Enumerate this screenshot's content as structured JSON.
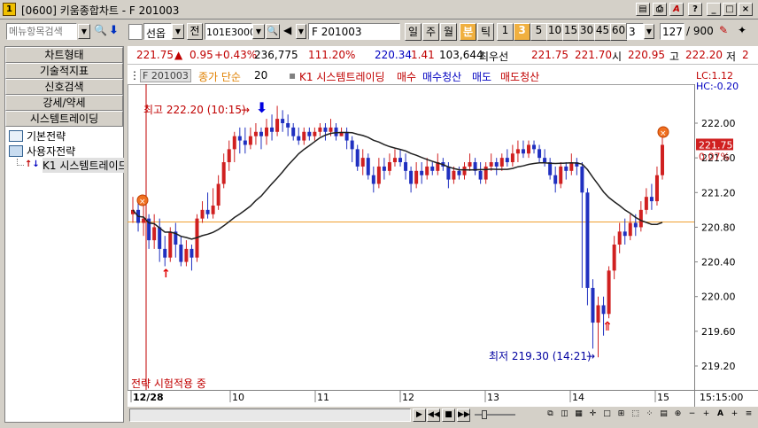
{
  "window": {
    "app_icon": "1",
    "title": "[0600] 키움종합차트 - F 201003",
    "title_buttons": [
      "chart-icon",
      "print-icon",
      "A",
      "?",
      "_",
      "□",
      "×"
    ]
  },
  "toolbar": {
    "menu_search_placeholder": "메뉴항목검색",
    "market": "선옵",
    "jeon": "전",
    "code": "101E3000",
    "name": "F 201003",
    "periods": [
      "일",
      "주",
      "월",
      "분",
      "틱",
      "1",
      "3",
      "5",
      "10",
      "15",
      "30",
      "45",
      "60"
    ],
    "selected_period": "분",
    "selected_value": "3",
    "interval_input": "3",
    "count_input": "127",
    "count_total": "/ 900"
  },
  "sidebar": {
    "buttons": [
      "차트형태",
      "기술적지표",
      "신호검색",
      "강세/약세",
      "시스템트레이딩"
    ],
    "tree": [
      {
        "label": "기본전략",
        "icon": "folder-icon"
      },
      {
        "label": "사용자전략",
        "icon": "folder-open-icon"
      },
      {
        "label": "K1 시스템트레이드",
        "icon": "strategy-icon"
      }
    ]
  },
  "quote": {
    "price": "221.75",
    "change_arrow": "▲",
    "change": "0.95",
    "change_pct": "+0.43%",
    "volume": "236,775",
    "volume_pct": "111.20%",
    "value1": "220.34",
    "value2": "1.41",
    "value3": "103,644",
    "best_label": "최우선",
    "best_bid": "221.75",
    "best_ask": "221.70",
    "open_label": "시",
    "open": "220.95",
    "high_label": "고",
    "high": "222.20",
    "low_label": "저",
    "low": "2"
  },
  "legend": {
    "symbol": "F 201003",
    "ma_label": "종가 단순",
    "ma_period": "20",
    "strategy": "K1 시스템트레이딩",
    "buy": "매수",
    "buy_exit": "매수청산",
    "sell": "매도",
    "sell_exit": "매도청산",
    "lc": "LC:1.12",
    "hc": "HC:-0.20"
  },
  "annotations": {
    "high_text": "최고 222.20 (10:15)",
    "low_text": "최저 219.30 (14:21)",
    "status_text": "전략 시험적용 중",
    "price_tag": "221.75",
    "pct_tag": "0.07%"
  },
  "chart_data": {
    "type": "candlestick",
    "y_ticks": [
      "222.00",
      "221.60",
      "221.20",
      "220.80",
      "220.40",
      "220.00",
      "219.60",
      "219.20"
    ],
    "ylim": [
      219.0,
      222.5
    ],
    "x_ticks": [
      "12/28",
      "10",
      "11",
      "12",
      "13",
      "14",
      "15"
    ],
    "time_label": "15:15:00",
    "reference_line": 220.86,
    "last_price": 221.75,
    "high": 222.2,
    "high_time": "10:15",
    "low": 219.3,
    "low_time": "14:21",
    "candles": [
      [
        220.95,
        221.0,
        221.15,
        220.85
      ],
      [
        221.0,
        220.85,
        221.1,
        220.75
      ],
      [
        220.85,
        220.9,
        221.05,
        220.7
      ],
      [
        220.9,
        220.65,
        220.95,
        220.55
      ],
      [
        220.65,
        220.8,
        220.95,
        220.55
      ],
      [
        220.8,
        220.55,
        220.9,
        220.4
      ],
      [
        220.55,
        220.45,
        220.7,
        220.35
      ],
      [
        220.45,
        220.75,
        220.8,
        220.4
      ],
      [
        220.75,
        220.6,
        220.85,
        220.45
      ],
      [
        220.6,
        220.4,
        220.7,
        220.35
      ],
      [
        220.4,
        220.55,
        220.65,
        220.35
      ],
      [
        220.55,
        220.45,
        220.6,
        220.3
      ],
      [
        220.45,
        220.9,
        220.95,
        220.4
      ],
      [
        220.9,
        221.0,
        221.1,
        220.85
      ],
      [
        221.0,
        220.95,
        221.2,
        220.9
      ],
      [
        220.95,
        221.05,
        221.25,
        220.9
      ],
      [
        221.05,
        221.3,
        221.4,
        221.0
      ],
      [
        221.3,
        221.55,
        221.65,
        221.25
      ],
      [
        221.55,
        221.7,
        221.8,
        221.45
      ],
      [
        221.7,
        221.85,
        221.9,
        221.55
      ],
      [
        221.85,
        221.8,
        221.95,
        221.65
      ],
      [
        221.8,
        221.75,
        221.95,
        221.65
      ],
      [
        221.75,
        221.85,
        221.95,
        221.7
      ],
      [
        221.85,
        221.9,
        222.0,
        221.75
      ],
      [
        221.9,
        221.85,
        221.95,
        221.7
      ],
      [
        221.85,
        221.95,
        222.05,
        221.75
      ],
      [
        221.95,
        221.9,
        222.1,
        221.8
      ],
      [
        221.9,
        222.05,
        222.2,
        221.85
      ],
      [
        222.05,
        222.0,
        222.15,
        221.9
      ],
      [
        222.0,
        221.95,
        222.1,
        221.85
      ],
      [
        221.95,
        221.85,
        222.0,
        221.8
      ],
      [
        221.85,
        221.8,
        221.95,
        221.75
      ],
      [
        221.8,
        221.9,
        221.95,
        221.75
      ],
      [
        221.9,
        221.85,
        221.95,
        221.8
      ],
      [
        221.85,
        221.9,
        221.95,
        221.8
      ],
      [
        221.9,
        221.95,
        222.0,
        221.85
      ],
      [
        221.95,
        221.9,
        222.0,
        221.8
      ],
      [
        221.9,
        221.95,
        222.05,
        221.85
      ],
      [
        221.95,
        221.85,
        222.0,
        221.8
      ],
      [
        221.85,
        221.9,
        221.95,
        221.85
      ],
      [
        221.9,
        221.8,
        221.95,
        221.7
      ],
      [
        221.8,
        221.7,
        221.85,
        221.55
      ],
      [
        221.7,
        221.5,
        221.75,
        221.45
      ],
      [
        221.5,
        221.6,
        221.7,
        221.4
      ],
      [
        221.6,
        221.4,
        221.65,
        221.35
      ],
      [
        221.4,
        221.3,
        221.5,
        221.2
      ],
      [
        221.3,
        221.5,
        221.6,
        221.25
      ],
      [
        221.5,
        221.45,
        221.6,
        221.35
      ],
      [
        221.45,
        221.55,
        221.65,
        221.4
      ],
      [
        221.55,
        221.6,
        221.7,
        221.5
      ],
      [
        221.6,
        221.55,
        221.7,
        221.5
      ],
      [
        221.55,
        221.45,
        221.65,
        221.35
      ],
      [
        221.45,
        221.3,
        221.5,
        221.2
      ],
      [
        221.3,
        221.45,
        221.55,
        221.25
      ],
      [
        221.45,
        221.4,
        221.55,
        221.3
      ],
      [
        221.4,
        221.5,
        221.6,
        221.35
      ],
      [
        221.5,
        221.45,
        221.55,
        221.4
      ],
      [
        221.45,
        221.55,
        221.65,
        221.4
      ],
      [
        221.55,
        221.5,
        221.6,
        221.45
      ],
      [
        221.5,
        221.35,
        221.55,
        221.25
      ],
      [
        221.35,
        221.45,
        221.5,
        221.3
      ],
      [
        221.45,
        221.4,
        221.5,
        221.35
      ],
      [
        221.4,
        221.5,
        221.55,
        221.35
      ],
      [
        221.5,
        221.55,
        221.65,
        221.45
      ],
      [
        221.55,
        221.45,
        221.6,
        221.4
      ],
      [
        221.45,
        221.35,
        221.55,
        221.3
      ],
      [
        221.35,
        221.5,
        221.55,
        221.3
      ],
      [
        221.5,
        221.55,
        221.65,
        221.45
      ],
      [
        221.55,
        221.5,
        221.6,
        221.4
      ],
      [
        221.5,
        221.6,
        221.65,
        221.45
      ],
      [
        221.6,
        221.55,
        221.7,
        221.5
      ],
      [
        221.55,
        221.65,
        221.75,
        221.5
      ],
      [
        221.65,
        221.7,
        221.8,
        221.55
      ],
      [
        221.7,
        221.65,
        221.8,
        221.6
      ],
      [
        221.65,
        221.75,
        221.8,
        221.6
      ],
      [
        221.75,
        221.7,
        221.8,
        221.65
      ],
      [
        221.7,
        221.6,
        221.75,
        221.55
      ],
      [
        221.6,
        221.55,
        221.7,
        221.5
      ],
      [
        221.55,
        221.4,
        221.6,
        221.35
      ],
      [
        221.4,
        221.3,
        221.5,
        221.2
      ],
      [
        221.3,
        221.5,
        221.55,
        221.25
      ],
      [
        221.5,
        221.45,
        221.55,
        221.35
      ],
      [
        221.45,
        221.55,
        221.65,
        221.4
      ],
      [
        221.55,
        221.5,
        221.6,
        221.4
      ],
      [
        221.5,
        221.2,
        221.55,
        220.1
      ],
      [
        221.2,
        220.1,
        221.25,
        219.9
      ],
      [
        220.1,
        219.7,
        220.2,
        219.4
      ],
      [
        219.7,
        219.9,
        220.0,
        219.3
      ],
      [
        219.9,
        219.8,
        220.0,
        219.55
      ],
      [
        219.8,
        220.3,
        220.35,
        219.75
      ],
      [
        220.3,
        220.6,
        220.7,
        220.2
      ],
      [
        220.6,
        220.75,
        220.85,
        220.5
      ],
      [
        220.75,
        220.7,
        220.9,
        220.6
      ],
      [
        220.7,
        220.85,
        220.95,
        220.65
      ],
      [
        220.85,
        220.8,
        220.95,
        220.7
      ],
      [
        220.8,
        221.0,
        221.1,
        220.75
      ],
      [
        221.0,
        221.15,
        221.25,
        220.95
      ],
      [
        221.15,
        221.1,
        221.3,
        221.0
      ],
      [
        221.1,
        221.4,
        221.5,
        221.05
      ],
      [
        221.4,
        221.75,
        221.85,
        221.35
      ]
    ]
  }
}
